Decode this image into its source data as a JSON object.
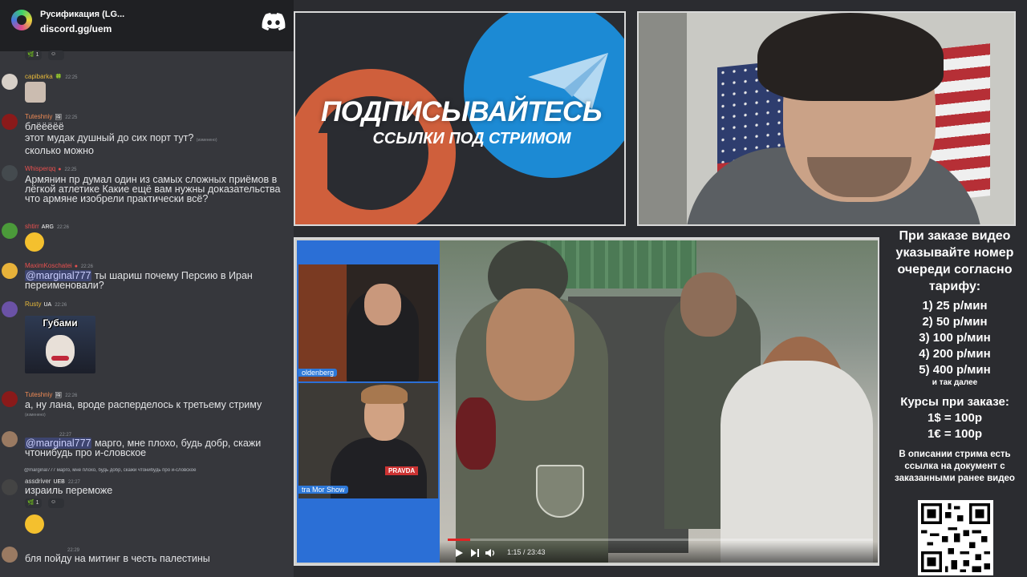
{
  "colors": {
    "discord_blurple": "#5865f2",
    "panel_border": "#d9d9d9",
    "chat_bg": "#36373c",
    "accent_red": "#e02424"
  },
  "server": {
    "name": "Русификация (LG...",
    "invite": "discord.gg/uem",
    "logo_icon": "discord-logo-icon"
  },
  "chat": {
    "top_reaction": {
      "count": "1"
    },
    "messages": [
      {
        "user": "capibarka",
        "badge": "🍀",
        "time": "22:25",
        "color": "#e6b83a"
      },
      {
        "user": "Tuteshniy",
        "badge": "🖼",
        "time": "22:25",
        "color": "#ee8a55",
        "lines": [
          "блёёёёё",
          "этот мудак душный до сих порт тут?",
          "сколько можно"
        ],
        "edited": "(изменено)"
      },
      {
        "user": "Whisperqq",
        "badge": "●",
        "time": "22:25",
        "color": "#e8504f",
        "text": "Армянин пр думал один из самых сложных приёмов в лёгкой атлетике Какие ещё вам нужны доказательства что армяне изобрели практически всё?"
      },
      {
        "user": "shtirr",
        "badge": "ARG",
        "time": "22:26",
        "color": "#e8504f"
      },
      {
        "user": "MaximKoschatei",
        "badge": "●",
        "time": "22:26",
        "color": "#e8504f",
        "mention": "@marginal777",
        "text": " ты шариш почему Персию в Иран переименовали?"
      },
      {
        "user": "Rusty",
        "badge": "UA",
        "time": "22:26",
        "color": "#e6b83a",
        "image_caption": "Губами"
      },
      {
        "user": "Tuteshniy",
        "badge": "🖼",
        "time": "22:26",
        "color": "#ee8a55",
        "text": "а, ну лана, вроде раcперделось к третьему стриму",
        "edited": "(изменено)"
      },
      {
        "user": "",
        "time": "22:27",
        "mention": "@marginal777",
        "text": " марго, мне плохо, будь добр, скажи чтонибудь про и-словское"
      },
      {
        "reply_preview": "@marginal777 марго, мне плохо, будь добр, скажи чтонибудь про и-словское",
        "user": "assdriver",
        "badge": "UEB",
        "time": "22:27",
        "color": "#dcddde",
        "text": "израиль переможе",
        "reaction_count": "1"
      },
      {
        "user": "",
        "time": "22:29",
        "text": "бля пойду на митинг в честь палестины"
      }
    ]
  },
  "promo": {
    "title": "ПОДПИСЫВАЙТЕСЬ",
    "subtitle": "ССЫЛКИ ПОД СТРИМОМ",
    "left_logo": "patreon-like-logo",
    "right_logo": "telegram-logo"
  },
  "video": {
    "stream_a_label": "oldenberg",
    "stream_b_label": "tra Mor Show",
    "shirt_text": "PRAVDA",
    "time": "1:15 / 23:43",
    "progress": 0.053
  },
  "info": {
    "header": "При заказе видео указывайте номер очереди согласно тарифу:",
    "prices": [
      "1) 25 р/мин",
      "2) 50 р/мин",
      "3) 100 р/мин",
      "4) 200 р/мин",
      "5) 400 р/мин"
    ],
    "more": "и так далее",
    "rates_title": "Курсы при заказе:",
    "rates": [
      "1$ = 100р",
      "1€ = 100р"
    ],
    "footer": "В описании стрима есть ссылка на документ с заказанными ранее видео"
  }
}
